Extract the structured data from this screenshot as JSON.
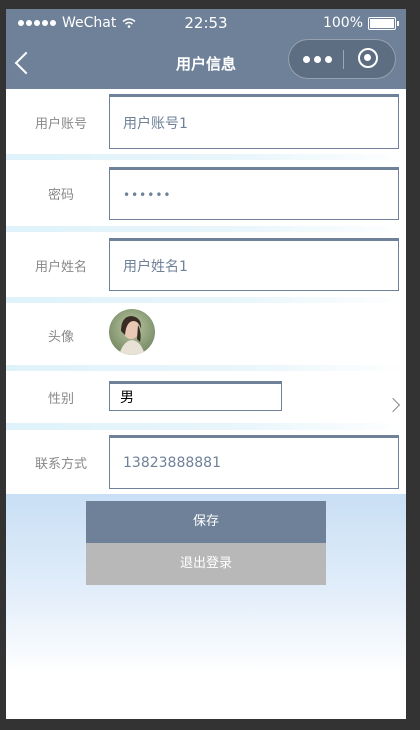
{
  "status_bar": {
    "carrier": "WeChat",
    "time": "22:53",
    "battery": "100%"
  },
  "nav": {
    "title": "用户信息"
  },
  "form": {
    "account": {
      "label": "用户账号",
      "value": "用户账号1"
    },
    "password": {
      "label": "密码",
      "value": "••••••"
    },
    "name": {
      "label": "用户姓名",
      "value": "用户姓名1"
    },
    "avatar": {
      "label": "头像"
    },
    "gender": {
      "label": "性别",
      "value": "男"
    },
    "contact": {
      "label": "联系方式",
      "value": "13823888881"
    }
  },
  "actions": {
    "save_label": "保存",
    "logout_label": "退出登录"
  },
  "colors": {
    "accent": "#6e8198",
    "logout": "#b8b8b8"
  }
}
